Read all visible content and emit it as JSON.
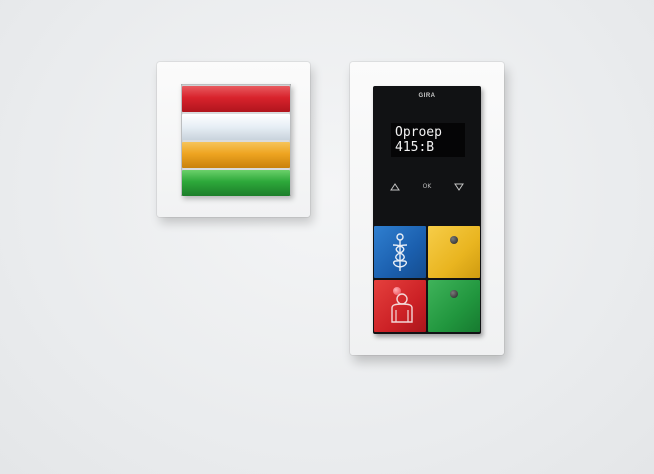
{
  "signal_light": {
    "lamps": [
      {
        "name": "red",
        "color": "#d8232c"
      },
      {
        "name": "white",
        "color": "#e6eef5"
      },
      {
        "name": "yellow",
        "color": "#eea421"
      },
      {
        "name": "green",
        "color": "#2da83a"
      }
    ]
  },
  "call_station": {
    "brand": "GIRA",
    "display_lines": [
      "Oproep",
      "415:B"
    ],
    "nav": {
      "up_icon": "triangle-up-icon",
      "ok_label": "OK",
      "down_icon": "triangle-down-icon"
    },
    "keys": [
      {
        "id": "blue",
        "color": "#1b5fae",
        "icon": "caduceus-icon"
      },
      {
        "id": "yellow",
        "color": "#e9b520",
        "icon": "led-indicator"
      },
      {
        "id": "red",
        "color": "#cc2126",
        "icon": "person-icon"
      },
      {
        "id": "green",
        "color": "#21963e",
        "icon": "led-indicator"
      }
    ]
  }
}
